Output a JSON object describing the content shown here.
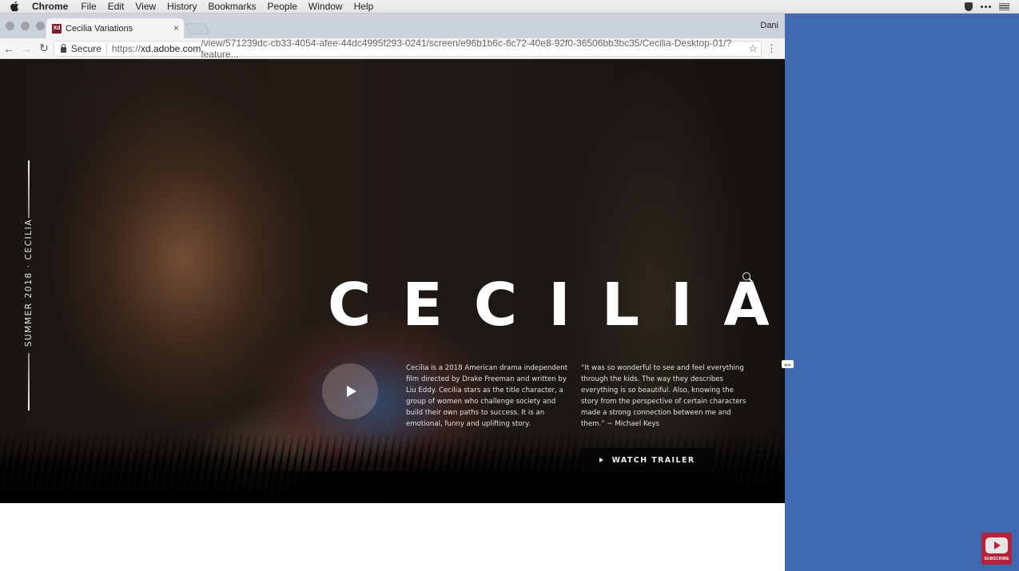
{
  "menubar": {
    "app_name": "Chrome",
    "items": [
      "File",
      "Edit",
      "View",
      "History",
      "Bookmarks",
      "People",
      "Window",
      "Help"
    ]
  },
  "browser": {
    "tab_title": "Cecilia Variations",
    "tab_icon_label": "Xd",
    "tab_close": "×",
    "profile_name": "Dani",
    "secure_label": "Secure",
    "url_scheme": "https://",
    "url_host": "xd.adobe.com",
    "url_path": "/view/571239dc-cb33-4054-afee-44dc4995f293-0241/screen/e96b1b6c-6c72-40e8-92f0-36506bb3bc35/Cecilia-Desktop-01/?feature...",
    "back_icon": "←",
    "forward_icon": "→",
    "reload_icon": "↻",
    "star_icon": "☆",
    "menu_icon": "⋮"
  },
  "hero": {
    "side_label": "SUMMER 2018 · CECILIA",
    "title": "CECILIA",
    "synopsis": "Cecilia is a 2018 American drama independent film directed by Drake Freeman and written by Liu Eddy. Cecilia stars as the title character, a group of women who challenge society and build their own paths to success. It is an emotional, funny and uplifting story.",
    "quote": "“It was so wonderful to see and feel everything through the kids. The way they describes everything is so beautiful. Also, knowing the story from the perspective of certain characters made a strong connection between me and them.” ~ Michael Keys",
    "trailer_button": "WATCH TRAILER"
  },
  "overlay": {
    "resize_cursor": "⇔",
    "subscribe_label": "SUBSCRIBE"
  },
  "colors": {
    "desktop_blue": "#3f69b1",
    "subscribe_red": "#b3243a",
    "xd_brand": "#7c1d2d"
  }
}
